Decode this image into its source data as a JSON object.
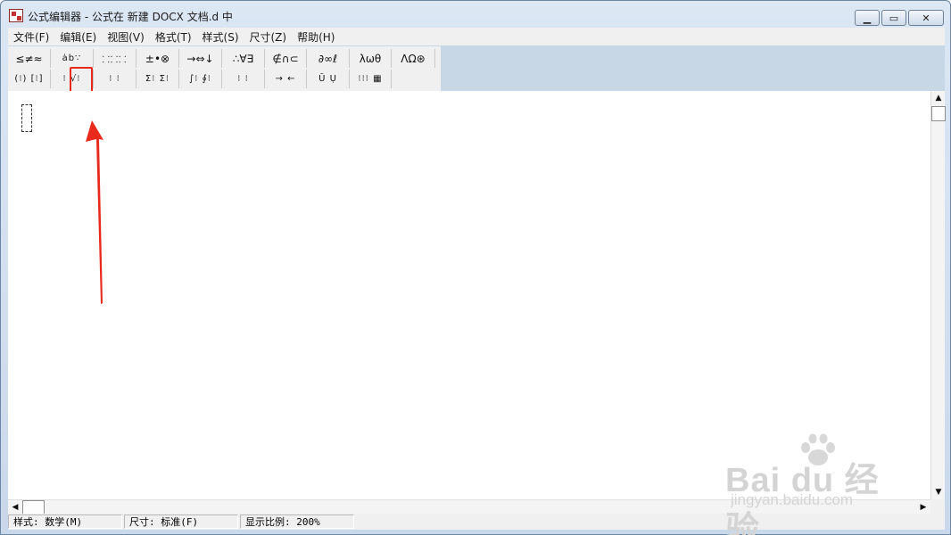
{
  "window": {
    "title": "公式编辑器 - 公式在 新建 DOCX 文档.d 中",
    "minimize_glyph": "▁",
    "maximize_glyph": "▭",
    "close_glyph": "✕"
  },
  "menu": {
    "items": [
      "文件(F)",
      "编辑(E)",
      "视图(V)",
      "格式(T)",
      "样式(S)",
      "尺寸(Z)",
      "帮助(H)"
    ]
  },
  "toolbar": {
    "row1": [
      "≤≠≈",
      "ȧb∵",
      "⸬⸬⸬",
      "±•⊗",
      "→⇔↓",
      "∴∀∃",
      "∉∩⊂",
      "∂∞ℓ",
      "λωθ",
      "ΛΩ⊛"
    ],
    "row2": [
      "(⁝) [⁝]",
      "⁝ √⁝",
      "⁝ ⁝",
      "Σ⁝ Σ⁝",
      "∫⁝ ∮⁝",
      "⁝ ⁝",
      "→ ←",
      "Ū Ụ",
      "⁝⁝⁝ ▦"
    ],
    "highlighted_tool": "square-root-template-button"
  },
  "scrollbars": {
    "up_arrow": "▲",
    "down_arrow": "▼",
    "left_arrow": "◀",
    "right_arrow": "▶"
  },
  "status": {
    "style": "样式: 数学(M)",
    "size": "尺寸: 标准(F)",
    "zoom": "显示比例: 200%"
  },
  "watermark": {
    "text": "Bai du 经验",
    "url_text": "jingyan.baidu.com"
  },
  "colors": {
    "highlight": "#e8291c",
    "arrow": "#e8291c",
    "toolbar_band": "#c8d7e6"
  }
}
